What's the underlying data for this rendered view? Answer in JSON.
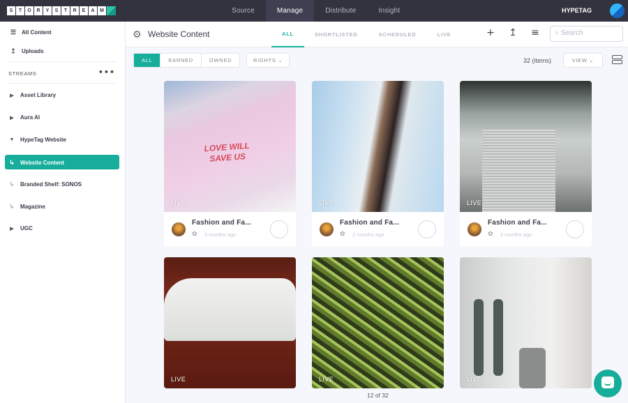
{
  "topbar": {
    "logo_letters": [
      "S",
      "T",
      "O",
      "R",
      "Y",
      "S",
      "T",
      "R",
      "E",
      "A",
      "M"
    ],
    "nav": [
      {
        "label": "Source",
        "active": false
      },
      {
        "label": "Manage",
        "active": true
      },
      {
        "label": "Distribute",
        "active": false
      },
      {
        "label": "Insight",
        "active": false
      }
    ],
    "brand": "HYPETAG"
  },
  "sidebar": {
    "all_content": "All Content",
    "uploads": "Uploads",
    "streams_heading": "STREAMS",
    "items": [
      {
        "label": "Asset Library",
        "icon": "caret-right-icon"
      },
      {
        "label": "Aura AI",
        "icon": "caret-right-icon"
      },
      {
        "label": "HypeTag Website",
        "icon": "caret-down-icon"
      },
      {
        "label": "Website Content",
        "icon": "sub-arrow-icon",
        "active": true
      },
      {
        "label": "Branded Shelf: SONOS",
        "icon": "sub-arrow-icon"
      },
      {
        "label": "Magazine",
        "icon": "sub-arrow-icon"
      },
      {
        "label": "UGC",
        "icon": "caret-right-icon"
      }
    ]
  },
  "header": {
    "title": "Website Content",
    "tabs": [
      "ALL",
      "SHORTLISTED",
      "SCHEDULED",
      "LIVE"
    ],
    "active_tab": "ALL",
    "search_placeholder": "Search"
  },
  "toolbar": {
    "filters": [
      "ALL",
      "EARNED",
      "OWNED"
    ],
    "active_filter": "ALL",
    "rights_label": "RIGHTS",
    "item_count": "32 (items)",
    "view_label": "VIEW"
  },
  "cards": [
    {
      "status": "LIVE",
      "title": "Fashion and Fa...",
      "time": "2 months ago",
      "source": "twitter",
      "image": "pink t-shirt 'Love Will Save Us'"
    },
    {
      "status": "LIVE",
      "title": "Fashion and Fa...",
      "time": "2 months ago",
      "source": "twitter",
      "image": "woman by white building"
    },
    {
      "status": "LIVE",
      "title": "Fashion and Fa...",
      "time": "2 months ago",
      "source": "twitter",
      "image": "SONOS speaker"
    },
    {
      "status": "LIVE",
      "image": "white sneaker"
    },
    {
      "status": "LIVE",
      "image": "fern and sneaker"
    },
    {
      "status": "LIVE",
      "image": "interior with speakers"
    }
  ],
  "pager": "12 of 32",
  "colors": {
    "accent": "#16ad9b",
    "topbar": "#33323f"
  }
}
